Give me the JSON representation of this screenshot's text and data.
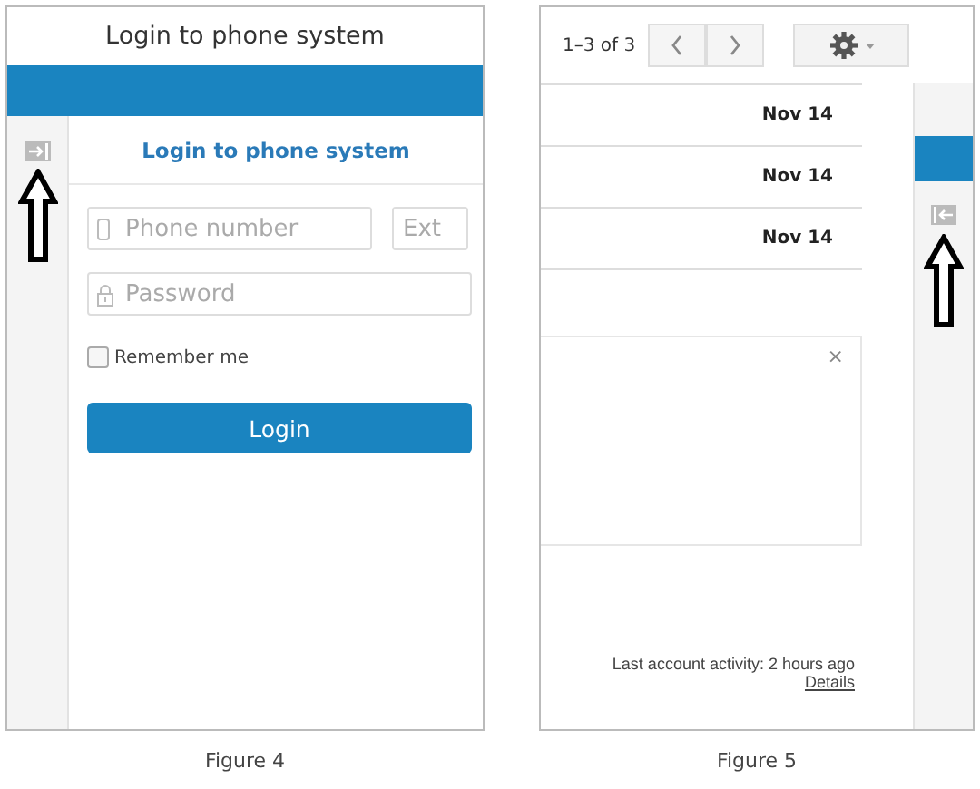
{
  "figure_4": {
    "header": {
      "title": "Login to phone system"
    },
    "form": {
      "heading": "Login to phone system",
      "phone_field": {
        "placeholder": "Phone number"
      },
      "ext_field": {
        "placeholder": "Ext"
      },
      "password_field": {
        "placeholder": "Password"
      },
      "remember": {
        "label": "Remember me",
        "checked": false
      },
      "button": "Login"
    },
    "caption": "Figure 4"
  },
  "figure_5": {
    "pagination": "1–3 of 3",
    "rows": [
      {
        "date": "Nov 14"
      },
      {
        "date": "Nov 14"
      },
      {
        "date": "Nov 14"
      }
    ],
    "notice": {
      "close": "×"
    },
    "activity": "Last account activity: 2 hours ago",
    "details_link": "Details",
    "caption": "Figure 5"
  }
}
